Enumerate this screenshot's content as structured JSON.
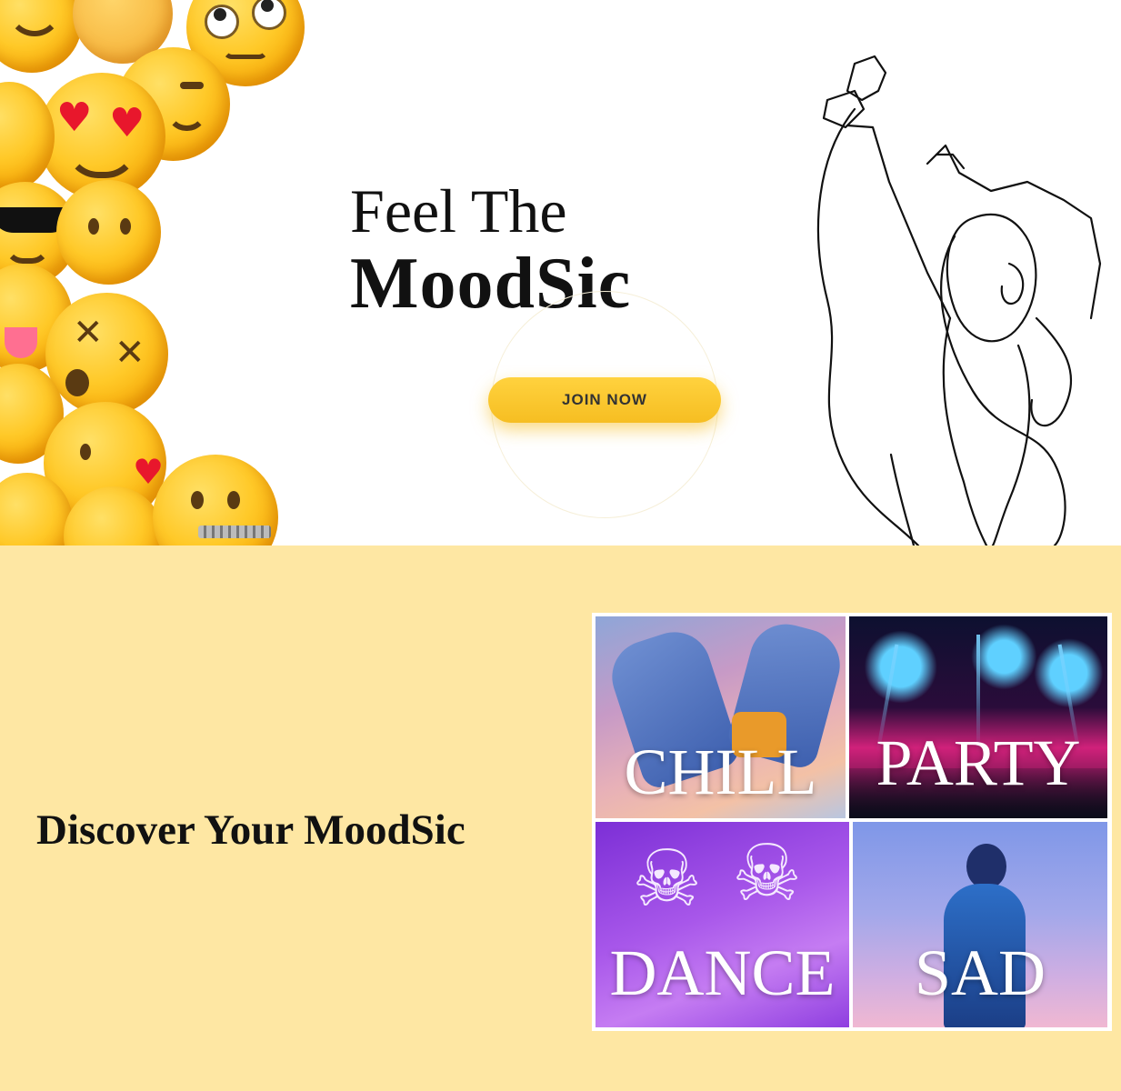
{
  "hero": {
    "title_line1": "Feel The",
    "title_line2": "MoodSic",
    "join_button": "JOIN NOW",
    "accent_color": "#f6be22"
  },
  "discover": {
    "title": "Discover Your MoodSic",
    "background_color": "#fee7a3",
    "moods": [
      {
        "label": "CHILL"
      },
      {
        "label": "PARTY"
      },
      {
        "label": "DANCE"
      },
      {
        "label": "SAD"
      }
    ]
  },
  "icons": {
    "emoji_decoration": "emoji-collage-icon",
    "line_art": "dancing-woman-line-art-icon"
  }
}
